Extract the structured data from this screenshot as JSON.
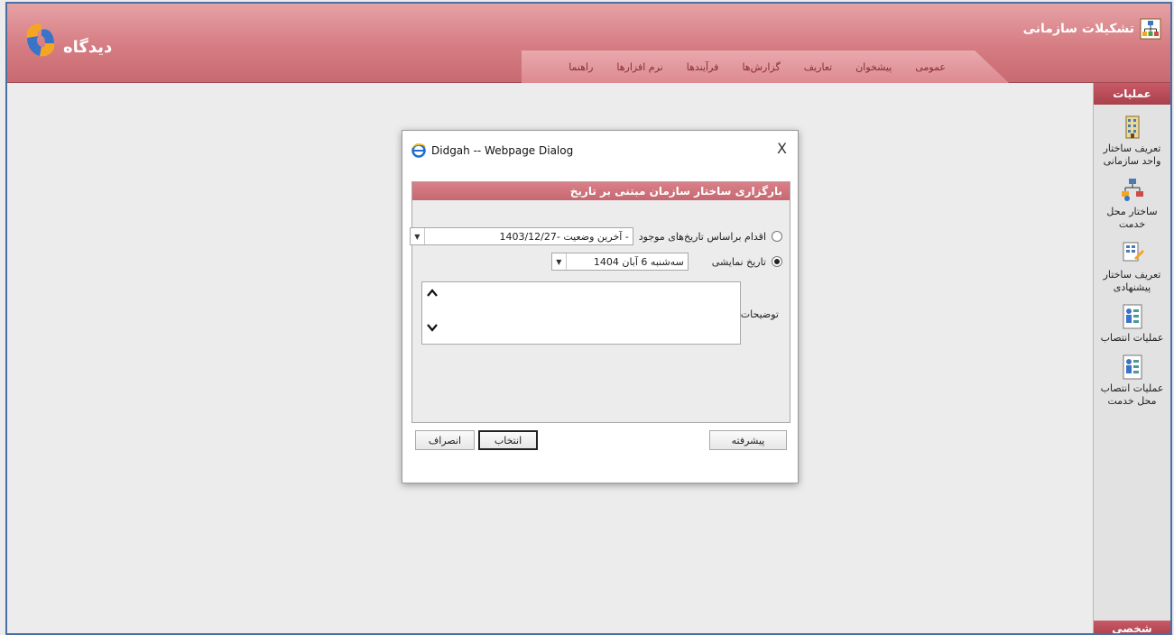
{
  "header": {
    "logo_text": "دیدگاه",
    "app_title": "تشکیلات سازمانی",
    "nav": [
      "عمومی",
      "پیشخوان",
      "تعاریف",
      "گزارش‌ها",
      "فرآیندها",
      "نرم افزارها",
      "راهنما"
    ]
  },
  "sidebar": {
    "header": "عملیات",
    "footer": "شخصی",
    "items": [
      {
        "label": "تعریف ساختار واحد سازمانی",
        "icon": "building-icon"
      },
      {
        "label": "ساختار محل خدمت",
        "icon": "org-chart-icon"
      },
      {
        "label": "تعریف ساختار پیشنهادی",
        "icon": "structure-edit-icon"
      },
      {
        "label": "عملیات انتصاب",
        "icon": "assignment-icon"
      },
      {
        "label": "عملیات انتصاب محل خدمت",
        "icon": "service-assignment-icon"
      }
    ]
  },
  "dialog": {
    "title": "Didgah -- Webpage Dialog",
    "close": "X",
    "section_header": "بارگزاری ساختار سازمان مبتنی بر تاریخ",
    "option_existing_label": "اقدام براساس تاریخ‌های موجود",
    "option_existing_value": "1403/12/27- آخرین وضعیت -",
    "option_display_label": "تاریخ نمایشی",
    "option_display_value": "سه‌شنبه 6 آبان 1404",
    "description_label": "توضیحات",
    "btn_advanced": "پیشرفته",
    "btn_select": "انتخاب",
    "btn_cancel": "انصراف"
  }
}
